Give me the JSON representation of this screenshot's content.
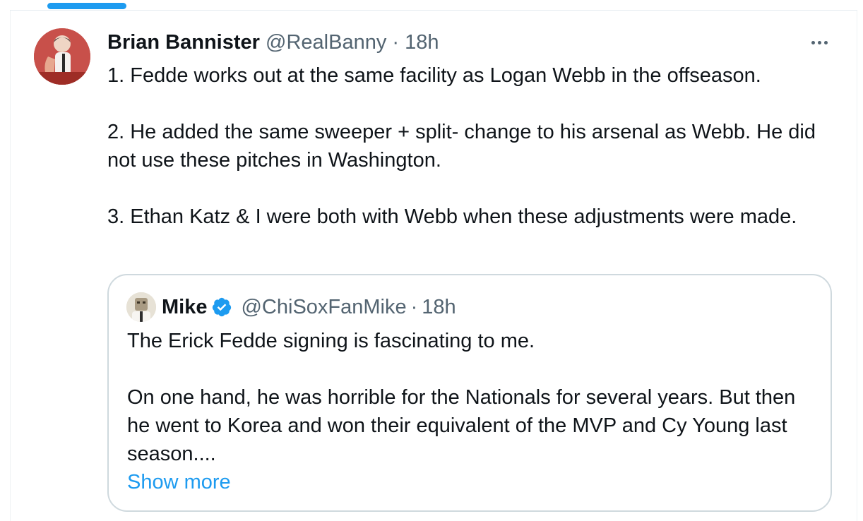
{
  "tweet": {
    "author_name": "Brian Bannister",
    "author_handle": "@RealBanny",
    "separator": "·",
    "time": "18h",
    "more_icon": "ellipsis-icon",
    "paragraphs": [
      "1. Fedde works out at the same facility as Logan Webb in the offseason.",
      "2. He added the same sweeper + split- change to his arsenal as Webb. He did not use these pitches in Washington.",
      "3. Ethan Katz & I were both with Webb when these adjustments were made."
    ]
  },
  "quoted_tweet": {
    "author_name": "Mike",
    "verified_icon": "verified-badge-icon",
    "author_handle": "@ChiSoxFanMike",
    "separator": "·",
    "time": "18h",
    "paragraphs": [
      "The Erick Fedde signing is fascinating to me.",
      "On one hand, he was horrible for the Nationals for several years. But then he went to Korea and won their equivalent of the MVP and Cy Young last season...."
    ],
    "show_more_label": "Show more"
  },
  "colors": {
    "accent": "#1d9bf0",
    "text": "#0f1419",
    "secondary_text": "#536471",
    "border": "#cfd9de"
  }
}
